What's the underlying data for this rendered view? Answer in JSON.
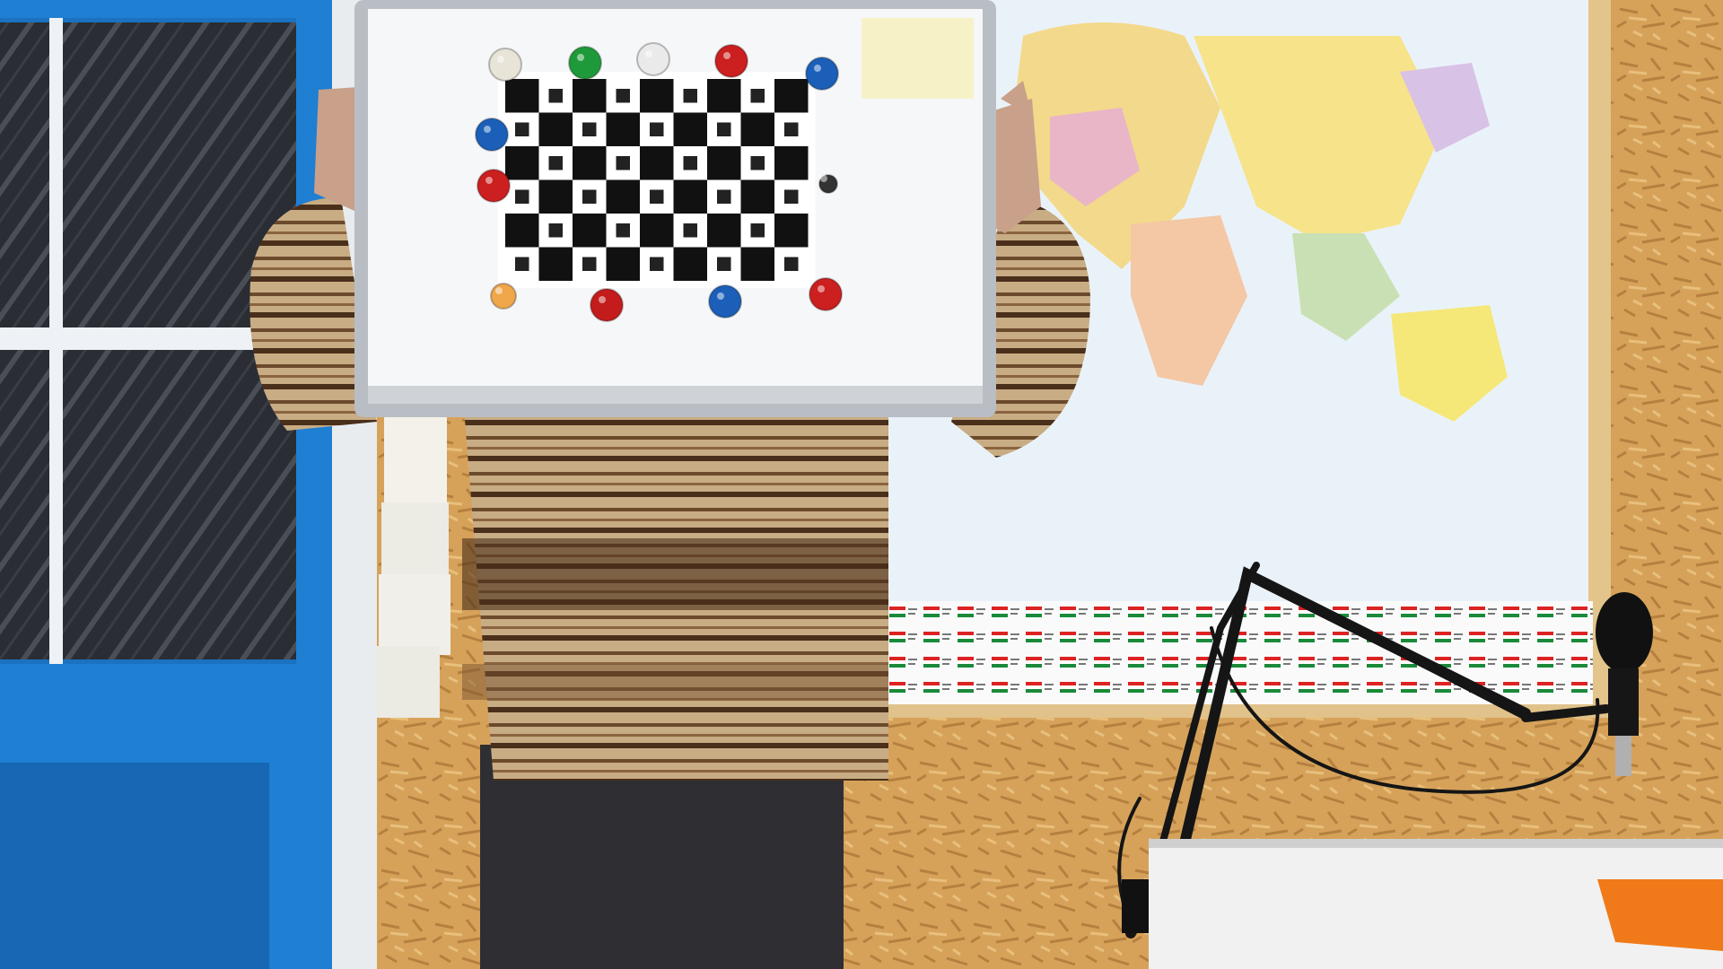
{
  "scene": {
    "description_colors": {
      "door_blue": "#1e7fd0",
      "osb_wall": "#d9a45c",
      "map_ocean": "#eef4fa",
      "sweater_tan": "#c9ae86",
      "sweater_brown": "#5a3a22",
      "board_white": "#f4f5f7",
      "desk_white": "#f2f2f2"
    },
    "calibration_board": {
      "rows": 6,
      "cols": 9
    },
    "magnets": [
      {
        "color": "#e8e4d8"
      },
      {
        "color": "#1f9a3a"
      },
      {
        "color": "#eaeaea"
      },
      {
        "color": "#cc1f1f"
      },
      {
        "color": "#1b5fb8"
      },
      {
        "color": "#1b5fb8"
      },
      {
        "color": "#cc1f1f"
      },
      {
        "color": "#333333"
      },
      {
        "color": "#f0a64a"
      },
      {
        "color": "#c41c1c"
      },
      {
        "color": "#1b5fb8"
      },
      {
        "color": "#cc1f1f"
      }
    ]
  }
}
